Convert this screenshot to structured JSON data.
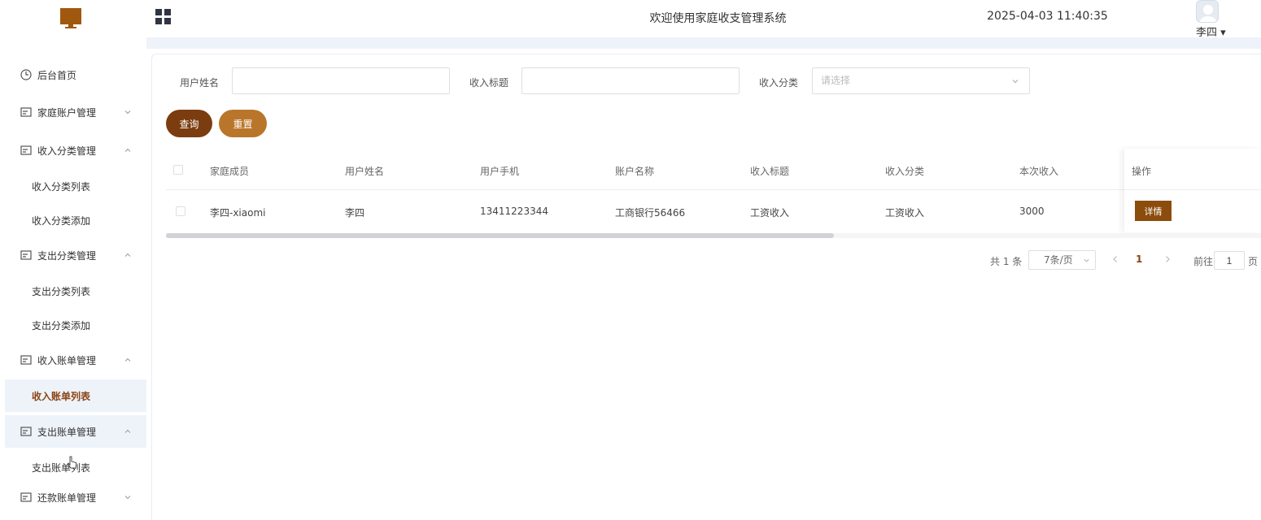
{
  "header": {
    "app_title": "欢迎使用家庭收支管理系统",
    "datetime": "2025-04-03 11:40:35",
    "user_name": "李四 ▾",
    "logo_icon": "monitor-logo-icon",
    "menu_icon": "grid-icon"
  },
  "sidebar": {
    "items": [
      {
        "label": "后台首页",
        "icon": "clock-icon"
      },
      {
        "label": "家庭账户管理",
        "icon": "card-icon",
        "expanded": false
      },
      {
        "label": "收入分类管理",
        "icon": "card-icon",
        "expanded": true
      },
      {
        "label": "收入分类列表"
      },
      {
        "label": "收入分类添加"
      },
      {
        "label": "支出分类管理",
        "icon": "card-icon",
        "expanded": true
      },
      {
        "label": "支出分类列表"
      },
      {
        "label": "支出分类添加"
      },
      {
        "label": "收入账单管理",
        "icon": "card-icon",
        "expanded": true
      },
      {
        "label": "收入账单列表",
        "active": true
      },
      {
        "label": "支出账单管理",
        "icon": "card-icon",
        "expanded": true
      },
      {
        "label": "支出账单列表"
      },
      {
        "label": "还款账单管理",
        "icon": "card-icon",
        "expanded": false
      }
    ]
  },
  "filters": {
    "user_name_label": "用户姓名",
    "user_name_value": "",
    "income_title_label": "收入标题",
    "income_title_value": "",
    "income_category_label": "收入分类",
    "income_category_placeholder": "请选择"
  },
  "buttons": {
    "query": "查询",
    "reset": "重置"
  },
  "table": {
    "columns": [
      "家庭成员",
      "用户姓名",
      "用户手机",
      "账户名称",
      "收入标题",
      "收入分类",
      "本次收入",
      "操作"
    ],
    "rows": [
      {
        "member": "李四-xiaomi",
        "user_name": "李四",
        "phone": "13411223344",
        "account": "工商银行56466",
        "title": "工资收入",
        "category": "工资收入",
        "amount": "3000",
        "action": "详情"
      }
    ]
  },
  "pagination": {
    "total": "共 1 条",
    "page_size": "7条/页",
    "current_page": "1",
    "goto_label": "前往",
    "goto_value": "1",
    "page_suffix": "页"
  },
  "colors": {
    "primary_dark": "#7b3d10",
    "primary_light": "#b9762b",
    "active_text": "#8b4513"
  }
}
